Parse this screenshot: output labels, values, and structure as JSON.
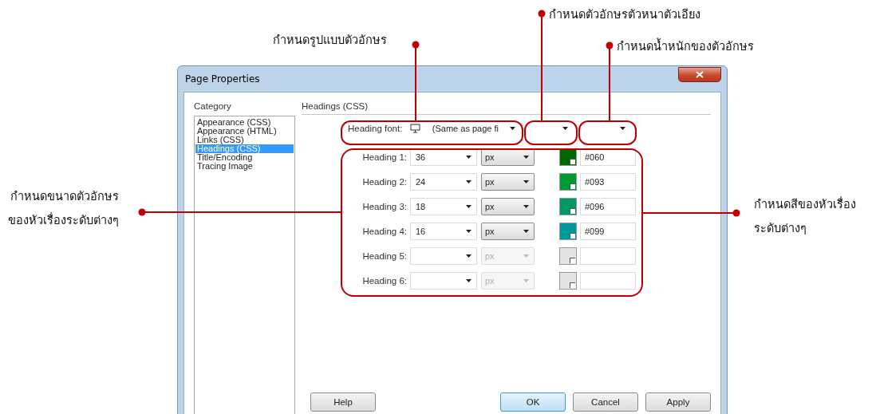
{
  "window": {
    "title": "Page Properties"
  },
  "category": {
    "label": "Category",
    "items": [
      {
        "label": "Appearance (CSS)",
        "selected": false
      },
      {
        "label": "Appearance (HTML)",
        "selected": false
      },
      {
        "label": "Links (CSS)",
        "selected": false
      },
      {
        "label": "Headings (CSS)",
        "selected": true
      },
      {
        "label": "Title/Encoding",
        "selected": false
      },
      {
        "label": "Tracing Image",
        "selected": false
      }
    ]
  },
  "panel": {
    "title": "Headings (CSS)",
    "heading_font": {
      "label": "Heading font:",
      "value": "(Same as page fi"
    }
  },
  "headings": [
    {
      "label": "Heading 1:",
      "size": "36",
      "unit": "px",
      "disabled": false,
      "color": "#006600",
      "hex": "#060"
    },
    {
      "label": "Heading 2:",
      "size": "24",
      "unit": "px",
      "disabled": false,
      "color": "#009933",
      "hex": "#093"
    },
    {
      "label": "Heading 3:",
      "size": "18",
      "unit": "px",
      "disabled": false,
      "color": "#009966",
      "hex": "#096"
    },
    {
      "label": "Heading 4:",
      "size": "16",
      "unit": "px",
      "disabled": false,
      "color": "#009999",
      "hex": "#099"
    },
    {
      "label": "Heading 5:",
      "unit": "px",
      "disabled": true
    },
    {
      "label": "Heading 6:",
      "unit": "px",
      "disabled": true
    }
  ],
  "footer": {
    "left": [
      {
        "label": "Help",
        "focused": false
      }
    ],
    "right": [
      {
        "label": "OK",
        "focused": true
      },
      {
        "label": "Cancel",
        "focused": false
      },
      {
        "label": "Apply",
        "focused": false
      }
    ]
  },
  "annotations": [
    {
      "lines": [
        "กำหนดรูปแบบตัวอักษร"
      ]
    },
    {
      "lines": [
        "กำหนดตัวอักษรตัวหนาตัวเอียง"
      ]
    },
    {
      "lines": [
        "กำหนดน้ำหนักของตัวอักษร"
      ]
    },
    {
      "lines": [
        "กำหนดขนาดตัวอักษร",
        "ของหัวเรื่องระดับต่างๆ"
      ]
    },
    {
      "lines": [
        "กำหนดสีของหัวเรื่อง",
        "ระดับต่างๆ"
      ]
    }
  ]
}
